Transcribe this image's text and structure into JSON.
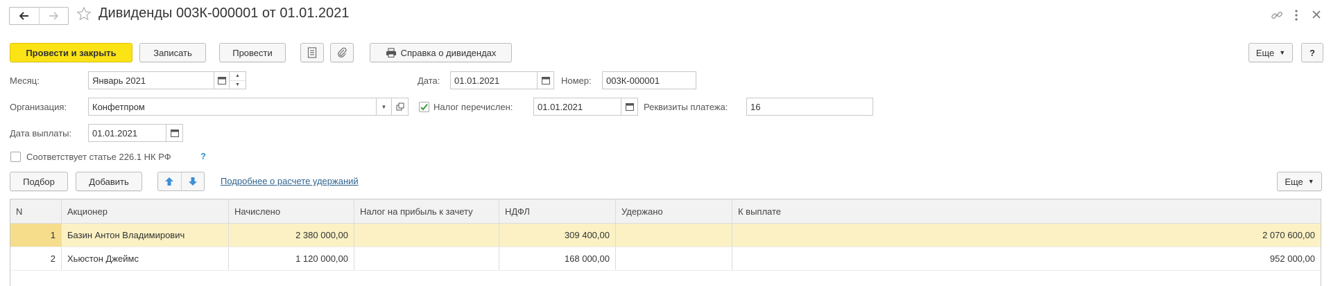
{
  "window": {
    "title": "Дивиденды 003К-000001 от 01.01.2021"
  },
  "toolbar": {
    "post_close": "Провести и закрыть",
    "save": "Записать",
    "post": "Провести",
    "report": "Справка о дивидендах",
    "more": "Еще",
    "help": "?"
  },
  "form": {
    "month_label": "Месяц:",
    "month_value": "Январь 2021",
    "date_label": "Дата:",
    "date_value": "01.01.2021",
    "number_label": "Номер:",
    "number_value": "003К-000001",
    "org_label": "Организация:",
    "org_value": "Конфетпром",
    "tax_paid_label": "Налог перечислен:",
    "tax_paid_checked": true,
    "tax_paid_date": "01.01.2021",
    "payment_details_label": "Реквизиты платежа:",
    "payment_details_value": "16",
    "pay_date_label": "Дата выплаты:",
    "pay_date_value": "01.01.2021",
    "art226_label": "Соответствует статье 226.1 НК РФ",
    "art226_checked": false,
    "art226_help": "?"
  },
  "table_toolbar": {
    "select": "Подбор",
    "add": "Добавить",
    "details_link": "Подробнее о расчете удержаний",
    "more": "Еще"
  },
  "table": {
    "columns": [
      "N",
      "Акционер",
      "Начислено",
      "Налог на прибыль к зачету",
      "НДФЛ",
      "Удержано",
      "К выплате"
    ],
    "rows": [
      [
        "1",
        "Базин Антон Владимирович",
        "2 380 000,00",
        "",
        "309 400,00",
        "",
        "2 070 600,00"
      ],
      [
        "2",
        "Хьюстон Джеймс",
        "1 120 000,00",
        "",
        "168 000,00",
        "",
        "952 000,00"
      ]
    ]
  },
  "colors": {
    "primary_button": "#fbe316",
    "selected_row": "#fbf1c4",
    "link": "#2f6490",
    "arrow_icon": "#3d8fd6",
    "check_mark": "#3a9a3a"
  }
}
